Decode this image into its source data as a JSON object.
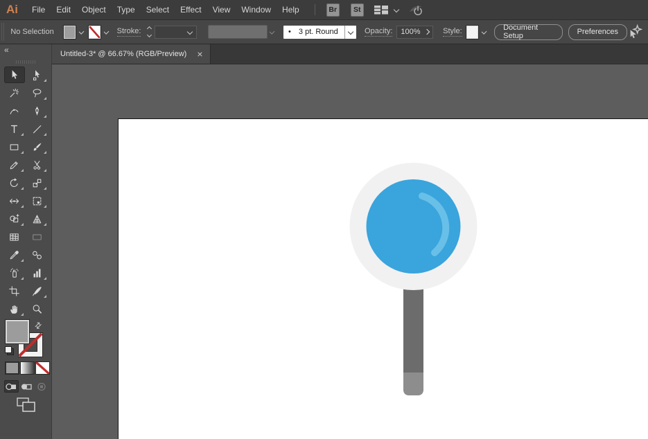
{
  "app": {
    "logo_text": "Ai"
  },
  "menubar": {
    "items": [
      "File",
      "Edit",
      "Object",
      "Type",
      "Select",
      "Effect",
      "View",
      "Window",
      "Help"
    ],
    "bridge_label": "Br",
    "stock_label": "St"
  },
  "control_bar": {
    "no_selection": "No Selection",
    "stroke_label": "Stroke:",
    "brush_bullet": "•",
    "brush_definition": "3 pt. Round",
    "opacity_label": "Opacity:",
    "opacity_value": "100%",
    "style_label": "Style:",
    "document_setup_button": "Document Setup",
    "preferences_button": "Preferences"
  },
  "document_tab": {
    "title": "Untitled-3* @ 66.67% (RGB/Preview)",
    "close_glyph": "×"
  },
  "toolbar": {
    "collapse_glyph": "«",
    "tools": [
      {
        "id": "selection",
        "icon": "selection-tool-icon",
        "active": true,
        "flyout": false
      },
      {
        "id": "direct-selection",
        "icon": "direct-selection-tool-icon",
        "active": false,
        "flyout": true
      },
      {
        "id": "magic-wand",
        "icon": "magic-wand-tool-icon",
        "active": false,
        "flyout": false
      },
      {
        "id": "lasso",
        "icon": "lasso-tool-icon",
        "active": false,
        "flyout": true
      },
      {
        "id": "curvature",
        "icon": "curvature-tool-icon",
        "active": false,
        "flyout": false
      },
      {
        "id": "pen",
        "icon": "pen-tool-icon",
        "active": false,
        "flyout": true
      },
      {
        "id": "type",
        "icon": "type-tool-icon",
        "active": false,
        "flyout": true
      },
      {
        "id": "line-segment",
        "icon": "line-segment-tool-icon",
        "active": false,
        "flyout": true
      },
      {
        "id": "rectangle",
        "icon": "rectangle-tool-icon",
        "active": false,
        "flyout": true
      },
      {
        "id": "paintbrush",
        "icon": "paintbrush-tool-icon",
        "active": false,
        "flyout": true
      },
      {
        "id": "pencil",
        "icon": "pencil-tool-icon",
        "active": false,
        "flyout": true
      },
      {
        "id": "scissors",
        "icon": "scissors-tool-icon",
        "active": false,
        "flyout": true
      },
      {
        "id": "rotate",
        "icon": "rotate-tool-icon",
        "active": false,
        "flyout": true
      },
      {
        "id": "scale",
        "icon": "scale-tool-icon",
        "active": false,
        "flyout": true
      },
      {
        "id": "width",
        "icon": "width-tool-icon",
        "active": false,
        "flyout": true
      },
      {
        "id": "free-transform",
        "icon": "free-transform-tool-icon",
        "active": false,
        "flyout": true
      },
      {
        "id": "shape-builder",
        "icon": "shape-builder-tool-icon",
        "active": false,
        "flyout": true
      },
      {
        "id": "perspective-grid",
        "icon": "perspective-grid-tool-icon",
        "active": false,
        "flyout": true
      },
      {
        "id": "mesh",
        "icon": "mesh-tool-icon",
        "active": false,
        "flyout": false
      },
      {
        "id": "gradient",
        "icon": "gradient-tool-icon",
        "active": false,
        "flyout": false
      },
      {
        "id": "eyedropper",
        "icon": "eyedropper-tool-icon",
        "active": false,
        "flyout": true
      },
      {
        "id": "blend",
        "icon": "blend-tool-icon",
        "active": false,
        "flyout": false
      },
      {
        "id": "symbol-sprayer",
        "icon": "symbol-sprayer-tool-icon",
        "active": false,
        "flyout": true
      },
      {
        "id": "column-graph",
        "icon": "column-graph-tool-icon",
        "active": false,
        "flyout": true
      },
      {
        "id": "artboard",
        "icon": "artboard-tool-icon",
        "active": false,
        "flyout": false
      },
      {
        "id": "slice",
        "icon": "slice-tool-icon",
        "active": false,
        "flyout": true
      },
      {
        "id": "hand",
        "icon": "hand-tool-icon",
        "active": false,
        "flyout": true
      },
      {
        "id": "zoom",
        "icon": "zoom-tool-icon",
        "active": false,
        "flyout": false
      }
    ]
  },
  "colors": {
    "logo_orange": "#d2804e",
    "canvas_gray": "#5d5d5d",
    "artboard_white": "#ffffff",
    "none_red": "#c12c2c"
  },
  "illustration": {
    "name": "magnifying-glass",
    "ring_color": "#f1f1f2",
    "lens_color": "#3aa4dc",
    "highlight_color": "#68c0e8",
    "handle_color": "#6c6c6c",
    "handle_tip_color": "#8d8d8d"
  }
}
